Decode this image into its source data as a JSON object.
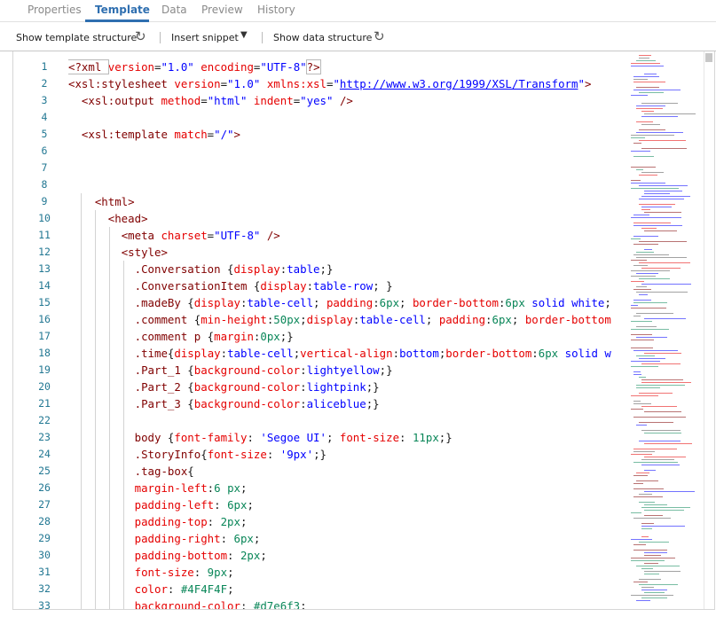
{
  "tabs": [
    {
      "label": "Properties",
      "active": false
    },
    {
      "label": "Template",
      "active": true
    },
    {
      "label": "Data",
      "active": false
    },
    {
      "label": "Preview",
      "active": false
    },
    {
      "label": "History",
      "active": false
    }
  ],
  "toolbar": {
    "show_template_structure": "Show template structure",
    "refresh_icon": "refresh-icon",
    "insert_snippet": "Insert snippet",
    "dropdown_icon": "caret-down-icon",
    "show_data_structure": "Show data structure"
  },
  "colors": {
    "accent": "#2f6fb0",
    "line_number": "#237893",
    "tag": "#800000",
    "attribute": "#e50000",
    "string": "#0000ff",
    "number": "#098658"
  },
  "editor": {
    "line_numbers": [
      "1",
      "2",
      "3",
      "4",
      "5",
      "6",
      "7",
      "8",
      "9",
      "10",
      "11",
      "12",
      "13",
      "14",
      "15",
      "16",
      "17",
      "18",
      "19",
      "20",
      "21",
      "22",
      "23",
      "24",
      "25",
      "26",
      "27",
      "28",
      "29",
      "30",
      "31",
      "32",
      "33"
    ],
    "lines": [
      [
        [
          "tag",
          "<?xml "
        ],
        [
          "attr",
          "version"
        ],
        [
          "plain",
          "="
        ],
        [
          "val",
          "\"1.0\""
        ],
        [
          "plain",
          " "
        ],
        [
          "attr",
          "encoding"
        ],
        [
          "plain",
          "="
        ],
        [
          "val",
          "\"UTF-8\""
        ],
        [
          "tag",
          "?>"
        ]
      ],
      [
        [
          "tag",
          "<xsl:stylesheet "
        ],
        [
          "attr",
          "version"
        ],
        [
          "plain",
          "="
        ],
        [
          "val",
          "\"1.0\""
        ],
        [
          "plain",
          " "
        ],
        [
          "attr",
          "xmlns:xsl"
        ],
        [
          "plain",
          "="
        ],
        [
          "val",
          "\""
        ],
        [
          "link",
          "http://www.w3.org/1999/XSL/Transform"
        ],
        [
          "val",
          "\""
        ],
        [
          "tag",
          ">"
        ]
      ],
      [
        [
          "plain",
          "  "
        ],
        [
          "tag",
          "<xsl:output "
        ],
        [
          "attr",
          "method"
        ],
        [
          "plain",
          "="
        ],
        [
          "val",
          "\"html\""
        ],
        [
          "plain",
          " "
        ],
        [
          "attr",
          "indent"
        ],
        [
          "plain",
          "="
        ],
        [
          "val",
          "\"yes\""
        ],
        [
          "plain",
          " "
        ],
        [
          "tag",
          "/>"
        ]
      ],
      [],
      [
        [
          "plain",
          "  "
        ],
        [
          "tag",
          "<xsl:template "
        ],
        [
          "attr",
          "match"
        ],
        [
          "plain",
          "="
        ],
        [
          "val",
          "\"/\""
        ],
        [
          "tag",
          ">"
        ]
      ],
      [],
      [],
      [],
      [
        [
          "plain",
          "    "
        ],
        [
          "tag",
          "<html>"
        ]
      ],
      [
        [
          "plain",
          "      "
        ],
        [
          "tag",
          "<head>"
        ]
      ],
      [
        [
          "plain",
          "        "
        ],
        [
          "tag",
          "<meta "
        ],
        [
          "attr",
          "charset"
        ],
        [
          "plain",
          "="
        ],
        [
          "val",
          "\"UTF-8\""
        ],
        [
          "plain",
          " "
        ],
        [
          "tag",
          "/>"
        ]
      ],
      [
        [
          "plain",
          "        "
        ],
        [
          "tag",
          "<style>"
        ]
      ],
      [
        [
          "plain",
          "          "
        ],
        [
          "sel",
          ".Conversation"
        ],
        [
          "plain",
          " {"
        ],
        [
          "prop",
          "display"
        ],
        [
          "plain",
          ":"
        ],
        [
          "val",
          "table"
        ],
        [
          "plain",
          ";}"
        ]
      ],
      [
        [
          "plain",
          "          "
        ],
        [
          "sel",
          ".ConversationItem"
        ],
        [
          "plain",
          " {"
        ],
        [
          "prop",
          "display"
        ],
        [
          "plain",
          ":"
        ],
        [
          "val",
          "table-row"
        ],
        [
          "plain",
          "; }"
        ]
      ],
      [
        [
          "plain",
          "          "
        ],
        [
          "sel",
          ".madeBy"
        ],
        [
          "plain",
          " {"
        ],
        [
          "prop",
          "display"
        ],
        [
          "plain",
          ":"
        ],
        [
          "val",
          "table-cell"
        ],
        [
          "plain",
          "; "
        ],
        [
          "prop",
          "padding"
        ],
        [
          "plain",
          ":"
        ],
        [
          "num",
          "6px"
        ],
        [
          "plain",
          "; "
        ],
        [
          "prop",
          "border-bottom"
        ],
        [
          "plain",
          ":"
        ],
        [
          "num",
          "6px"
        ],
        [
          "plain",
          " "
        ],
        [
          "val",
          "solid"
        ],
        [
          "plain",
          " "
        ],
        [
          "val",
          "white"
        ],
        [
          "plain",
          ";"
        ]
      ],
      [
        [
          "plain",
          "          "
        ],
        [
          "sel",
          ".comment"
        ],
        [
          "plain",
          " {"
        ],
        [
          "prop",
          "min-height"
        ],
        [
          "plain",
          ":"
        ],
        [
          "num",
          "50px"
        ],
        [
          "plain",
          ";"
        ],
        [
          "prop",
          "display"
        ],
        [
          "plain",
          ":"
        ],
        [
          "val",
          "table-cell"
        ],
        [
          "plain",
          "; "
        ],
        [
          "prop",
          "padding"
        ],
        [
          "plain",
          ":"
        ],
        [
          "num",
          "6px"
        ],
        [
          "plain",
          "; "
        ],
        [
          "prop",
          "border-bottom"
        ]
      ],
      [
        [
          "plain",
          "          "
        ],
        [
          "sel",
          ".comment p"
        ],
        [
          "plain",
          " {"
        ],
        [
          "prop",
          "margin"
        ],
        [
          "plain",
          ":"
        ],
        [
          "num",
          "0px"
        ],
        [
          "plain",
          ";}"
        ]
      ],
      [
        [
          "plain",
          "          "
        ],
        [
          "sel",
          ".time"
        ],
        [
          "plain",
          "{"
        ],
        [
          "prop",
          "display"
        ],
        [
          "plain",
          ":"
        ],
        [
          "val",
          "table-cell"
        ],
        [
          "plain",
          ";"
        ],
        [
          "prop",
          "vertical-align"
        ],
        [
          "plain",
          ":"
        ],
        [
          "val",
          "bottom"
        ],
        [
          "plain",
          ";"
        ],
        [
          "prop",
          "border-bottom"
        ],
        [
          "plain",
          ":"
        ],
        [
          "num",
          "6px"
        ],
        [
          "plain",
          " "
        ],
        [
          "val",
          "solid"
        ],
        [
          "plain",
          " "
        ],
        [
          "val",
          "w"
        ]
      ],
      [
        [
          "plain",
          "          "
        ],
        [
          "sel",
          ".Part_1"
        ],
        [
          "plain",
          " {"
        ],
        [
          "prop",
          "background-color"
        ],
        [
          "plain",
          ":"
        ],
        [
          "val",
          "lightyellow"
        ],
        [
          "plain",
          ";}"
        ]
      ],
      [
        [
          "plain",
          "          "
        ],
        [
          "sel",
          ".Part_2"
        ],
        [
          "plain",
          " {"
        ],
        [
          "prop",
          "background-color"
        ],
        [
          "plain",
          ":"
        ],
        [
          "val",
          "lightpink"
        ],
        [
          "plain",
          ";}"
        ]
      ],
      [
        [
          "plain",
          "          "
        ],
        [
          "sel",
          ".Part_3"
        ],
        [
          "plain",
          " {"
        ],
        [
          "prop",
          "background-color"
        ],
        [
          "plain",
          ":"
        ],
        [
          "val",
          "aliceblue"
        ],
        [
          "plain",
          ";}"
        ]
      ],
      [],
      [
        [
          "plain",
          "          "
        ],
        [
          "sel",
          "body"
        ],
        [
          "plain",
          " {"
        ],
        [
          "prop",
          "font-family"
        ],
        [
          "plain",
          ": "
        ],
        [
          "val",
          "'Segoe UI'"
        ],
        [
          "plain",
          "; "
        ],
        [
          "prop",
          "font-size"
        ],
        [
          "plain",
          ": "
        ],
        [
          "num",
          "11px"
        ],
        [
          "plain",
          ";}"
        ]
      ],
      [
        [
          "plain",
          "          "
        ],
        [
          "sel",
          ".StoryInfo"
        ],
        [
          "plain",
          "{"
        ],
        [
          "prop",
          "font-size"
        ],
        [
          "plain",
          ": "
        ],
        [
          "val",
          "'9px'"
        ],
        [
          "plain",
          ";}"
        ]
      ],
      [
        [
          "plain",
          "          "
        ],
        [
          "sel",
          ".tag-box"
        ],
        [
          "plain",
          "{"
        ]
      ],
      [
        [
          "plain",
          "          "
        ],
        [
          "prop",
          "margin-left"
        ],
        [
          "plain",
          ":"
        ],
        [
          "num",
          "6"
        ],
        [
          "plain",
          " "
        ],
        [
          "num",
          "px"
        ],
        [
          "plain",
          ";"
        ]
      ],
      [
        [
          "plain",
          "          "
        ],
        [
          "prop",
          "padding-left"
        ],
        [
          "plain",
          ": "
        ],
        [
          "num",
          "6px"
        ],
        [
          "plain",
          ";"
        ]
      ],
      [
        [
          "plain",
          "          "
        ],
        [
          "prop",
          "padding-top"
        ],
        [
          "plain",
          ": "
        ],
        [
          "num",
          "2px"
        ],
        [
          "plain",
          ";"
        ]
      ],
      [
        [
          "plain",
          "          "
        ],
        [
          "prop",
          "padding-right"
        ],
        [
          "plain",
          ": "
        ],
        [
          "num",
          "6px"
        ],
        [
          "plain",
          ";"
        ]
      ],
      [
        [
          "plain",
          "          "
        ],
        [
          "prop",
          "padding-bottom"
        ],
        [
          "plain",
          ": "
        ],
        [
          "num",
          "2px"
        ],
        [
          "plain",
          ";"
        ]
      ],
      [
        [
          "plain",
          "          "
        ],
        [
          "prop",
          "font-size"
        ],
        [
          "plain",
          ": "
        ],
        [
          "num",
          "9px"
        ],
        [
          "plain",
          ";"
        ]
      ],
      [
        [
          "plain",
          "          "
        ],
        [
          "prop",
          "color"
        ],
        [
          "plain",
          ": "
        ],
        [
          "num",
          "#4F4F4F"
        ],
        [
          "plain",
          ";"
        ]
      ],
      [
        [
          "plain",
          "          "
        ],
        [
          "prop",
          "background-color"
        ],
        [
          "plain",
          ": "
        ],
        [
          "num",
          "#d7e6f3"
        ],
        [
          "plain",
          ";"
        ]
      ]
    ]
  }
}
